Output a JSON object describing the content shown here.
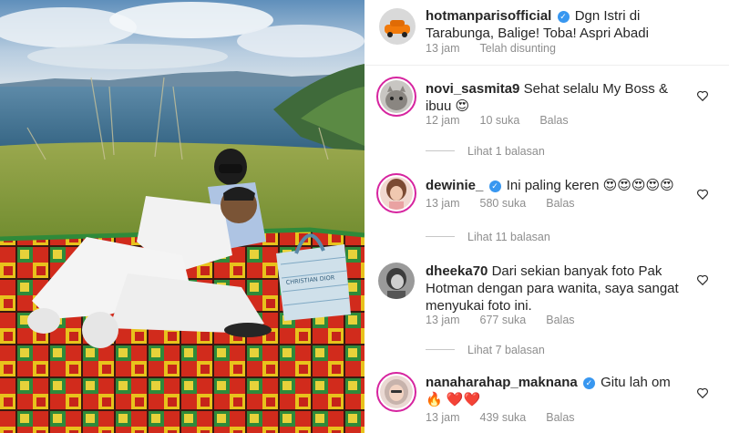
{
  "post": {
    "username": "hotmanparisofficial",
    "caption": "Dgn Istri di Tarabunga, Balige! Toba! Aspri Abadi",
    "time": "13 jam",
    "edited": "Telah disunting"
  },
  "comments": [
    {
      "username": "novi_sasmita9",
      "verified": false,
      "text": "Sehat selalu My Boss & ibuu 😍",
      "time": "12 jam",
      "likes": "10 suka",
      "reply_label": "Balas",
      "view_replies": "Lihat 1 balasan"
    },
    {
      "username": "dewinie_",
      "verified": true,
      "text": "Ini paling keren 😍😍😍😍😍",
      "time": "13 jam",
      "likes": "580 suka",
      "reply_label": "Balas",
      "view_replies": "Lihat 11 balasan"
    },
    {
      "username": "dheeka70",
      "verified": false,
      "text": "Dari sekian banyak foto Pak Hotman dengan para wanita, saya sangat menyukai foto ini.",
      "time": "13 jam",
      "likes": "677 suka",
      "reply_label": "Balas",
      "view_replies": "Lihat 7 balasan"
    },
    {
      "username": "nanaharahap_maknana",
      "verified": true,
      "text": "Gitu lah om 🔥 ❤️❤️",
      "time": "13 jam",
      "likes": "439 suka",
      "reply_label": "Balas"
    }
  ],
  "photo_bag_text": "CHRISTIAN DIOR",
  "colors": {
    "verified_blue": "#3897f0",
    "meta_gray": "#8e8e8e",
    "story_ring": "#d6249f"
  },
  "icons": {
    "verified": "verified-badge-icon",
    "like": "heart-outline-icon"
  }
}
